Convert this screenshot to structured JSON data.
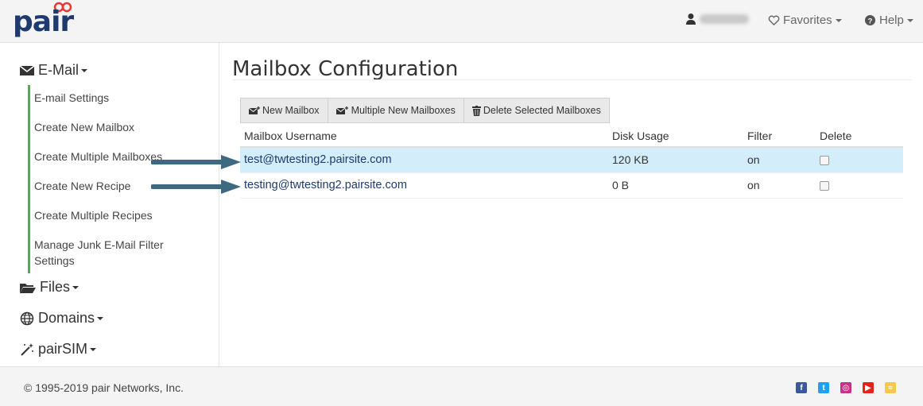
{
  "navbar": {
    "logo_text": "pair",
    "favorites_label": "Favorites",
    "help_label": "Help"
  },
  "sidebar": {
    "email_label": "E-Mail",
    "email_items": [
      {
        "label": "E-mail Settings"
      },
      {
        "label": "Create New Mailbox"
      },
      {
        "label": "Create Multiple Mailboxes"
      },
      {
        "label": "Create New Recipe"
      },
      {
        "label": "Create Multiple Recipes"
      },
      {
        "label": "Manage Junk E-Mail Filter Settings"
      }
    ],
    "files_label": "Files",
    "domains_label": "Domains",
    "pairsim_label": "pairSIM"
  },
  "main": {
    "title": "Mailbox Configuration",
    "toolbar": {
      "new_mailbox": "New Mailbox",
      "multiple_new": "Multiple New Mailboxes",
      "delete_selected": "Delete Selected Mailboxes"
    },
    "table": {
      "headers": [
        "Mailbox Username",
        "Disk Usage",
        "Filter",
        "Delete"
      ],
      "rows": [
        {
          "username": "test@twtesting2.pairsite.com",
          "usage": "120 KB",
          "filter": "on",
          "delete": false
        },
        {
          "username": "testing@twtesting2.pairsite.com",
          "usage": "0 B",
          "filter": "on",
          "delete": false
        }
      ]
    }
  },
  "footer": {
    "copyright": "© 1995-2019 pair Networks, Inc."
  },
  "colors": {
    "brand": "#1e3a6e",
    "accent_green": "#4caf50",
    "row_highlight": "#d4edfa",
    "arrow": "#3d6a80"
  },
  "icons": [
    "user-icon",
    "heart-icon",
    "help-icon",
    "envelope-icon",
    "folder-icon",
    "globe-icon",
    "magic-wand-icon",
    "trash-icon",
    "facebook-icon",
    "twitter-icon",
    "instagram-icon",
    "youtube-icon",
    "rss-icon"
  ]
}
